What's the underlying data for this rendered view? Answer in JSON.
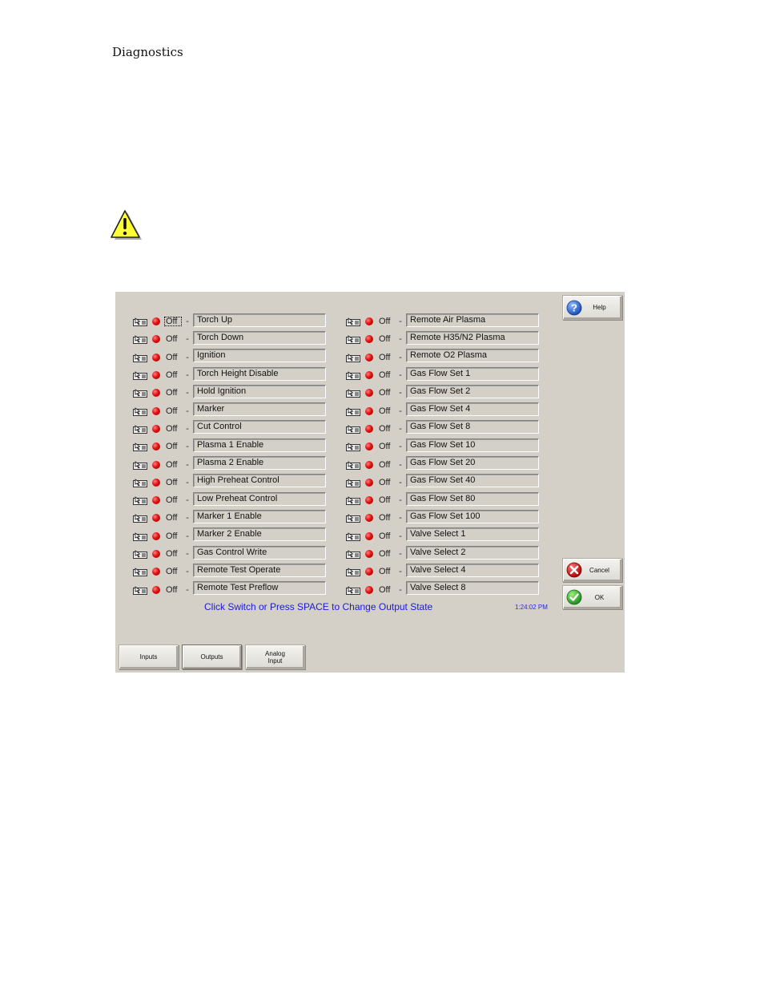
{
  "document": {
    "header": "Diagnostics",
    "warning_icon": "warning-triangle-icon"
  },
  "panel": {
    "left_outputs": [
      {
        "state": "Off",
        "name": "Torch Up",
        "focused": true
      },
      {
        "state": "Off",
        "name": "Torch Down"
      },
      {
        "state": "Off",
        "name": "Ignition"
      },
      {
        "state": "Off",
        "name": "Torch Height Disable"
      },
      {
        "state": "Off",
        "name": "Hold Ignition"
      },
      {
        "state": "Off",
        "name": "Marker"
      },
      {
        "state": "Off",
        "name": "Cut Control"
      },
      {
        "state": "Off",
        "name": "Plasma 1 Enable"
      },
      {
        "state": "Off",
        "name": "Plasma 2 Enable"
      },
      {
        "state": "Off",
        "name": "High Preheat Control"
      },
      {
        "state": "Off",
        "name": "Low Preheat Control"
      },
      {
        "state": "Off",
        "name": "Marker 1 Enable"
      },
      {
        "state": "Off",
        "name": "Marker 2 Enable"
      },
      {
        "state": "Off",
        "name": "Gas Control Write"
      },
      {
        "state": "Off",
        "name": "Remote Test Operate"
      },
      {
        "state": "Off",
        "name": "Remote Test Preflow"
      }
    ],
    "right_outputs": [
      {
        "state": "Off",
        "name": "Remote Air Plasma"
      },
      {
        "state": "Off",
        "name": "Remote H35/N2 Plasma"
      },
      {
        "state": "Off",
        "name": "Remote O2 Plasma"
      },
      {
        "state": "Off",
        "name": "Gas Flow Set 1"
      },
      {
        "state": "Off",
        "name": "Gas Flow Set 2"
      },
      {
        "state": "Off",
        "name": "Gas Flow Set 4"
      },
      {
        "state": "Off",
        "name": "Gas Flow Set 8"
      },
      {
        "state": "Off",
        "name": "Gas Flow Set 10"
      },
      {
        "state": "Off",
        "name": "Gas Flow Set 20"
      },
      {
        "state": "Off",
        "name": "Gas Flow Set 40"
      },
      {
        "state": "Off",
        "name": "Gas Flow Set 80"
      },
      {
        "state": "Off",
        "name": "Gas Flow Set 100"
      },
      {
        "state": "Off",
        "name": "Valve Select 1"
      },
      {
        "state": "Off",
        "name": "Valve Select 2"
      },
      {
        "state": "Off",
        "name": "Valve Select 4"
      },
      {
        "state": "Off",
        "name": "Valve Select 8"
      }
    ],
    "separator": "-",
    "hint": "Click Switch or Press SPACE to Change Output State",
    "clock": "1:24:02 PM",
    "led_color": "#e01010",
    "hint_color": "#1a1adc"
  },
  "buttons": {
    "help": "Help",
    "cancel": "Cancel",
    "ok": "OK"
  },
  "tabs": [
    {
      "label": "Inputs"
    },
    {
      "label": "Outputs",
      "active": true
    },
    {
      "label": "Analog\nInput"
    }
  ]
}
